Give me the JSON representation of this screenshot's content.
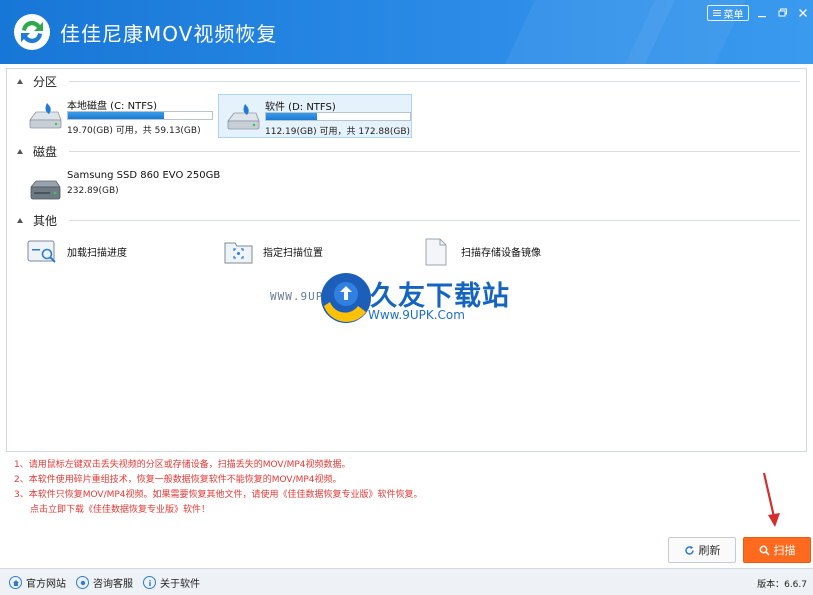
{
  "app": {
    "title": "佳佳尼康MOV视频恢复",
    "menu_label": "菜单"
  },
  "sections": {
    "partition": "分区",
    "disk": "磁盘",
    "other": "其他"
  },
  "partitions": [
    {
      "name": "本地磁盘 (C: NTFS)",
      "info": "19.70(GB) 可用，共 59.13(GB)",
      "used_fraction": 0.667,
      "selected": false
    },
    {
      "name": "软件 (D: NTFS)",
      "info": "112.19(GB) 可用，共 172.88(GB)",
      "used_fraction": 0.351,
      "selected": true
    }
  ],
  "disks": [
    {
      "name": "Samsung SSD 860 EVO 250GB",
      "info": "232.89(GB)"
    }
  ],
  "others": [
    {
      "label": "加载扫描进度"
    },
    {
      "label": "指定扫描位置"
    },
    {
      "label": "扫描存储设备镜像"
    }
  ],
  "watermark": {
    "left_text": "WWW.9UPK.COM",
    "brand": "久友下载站",
    "url": "Www.9UPK.Com"
  },
  "notes": [
    "1、请用鼠标左键双击丢失视频的分区或存储设备，扫描丢失的MOV/MP4视频数据。",
    "2、本软件使用碎片重组技术，恢复一般数据恢复软件不能恢复的MOV/MP4视频。",
    "3、本软件只恢复MOV/MP4视频。如果需要恢复其他文件，请使用《佳佳数据恢复专业版》软件恢复。",
    "点击立即下载《佳佳数据恢复专业版》软件！"
  ],
  "buttons": {
    "refresh": "刷新",
    "scan": "扫描"
  },
  "statusbar": {
    "website": "官方网站",
    "support": "咨询客服",
    "about": "关于软件",
    "version": "版本：6.6.7"
  },
  "colors": {
    "titlebar": "#2a8ae6",
    "scan_button": "#ff6a1f",
    "note_text": "#e53935",
    "selected_item": "#e5f1fb"
  }
}
